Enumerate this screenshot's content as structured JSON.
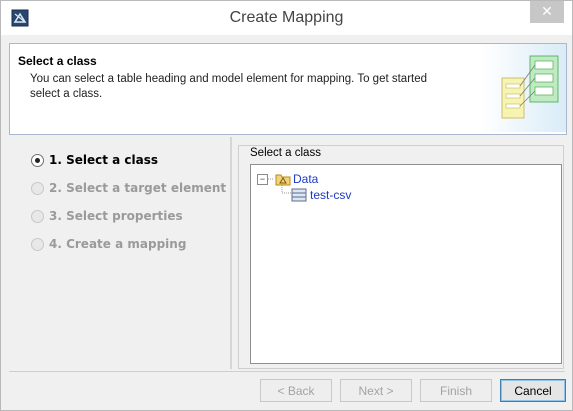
{
  "window": {
    "title": "Create Mapping",
    "close_glyph": "✕"
  },
  "header": {
    "title": "Select a class",
    "description": "You can select a table heading and model element for mapping. To get started select a class."
  },
  "steps": [
    {
      "label": "1. Select a class",
      "active": true
    },
    {
      "label": "2. Select a target element",
      "active": false
    },
    {
      "label": "3. Select properties",
      "active": false
    },
    {
      "label": "4. Create a mapping",
      "active": false
    }
  ],
  "class_panel": {
    "group_label": "Select a class",
    "tree": [
      {
        "label": "Data",
        "icon": "package-icon",
        "expanded": true
      },
      {
        "label": "test-csv",
        "icon": "class-icon"
      }
    ]
  },
  "buttons": {
    "back": "< Back",
    "next": "Next >",
    "finish": "Finish",
    "cancel": "Cancel"
  },
  "colors": {
    "tree_text": "#1e38c9",
    "header_border": "#a9b8cc"
  }
}
